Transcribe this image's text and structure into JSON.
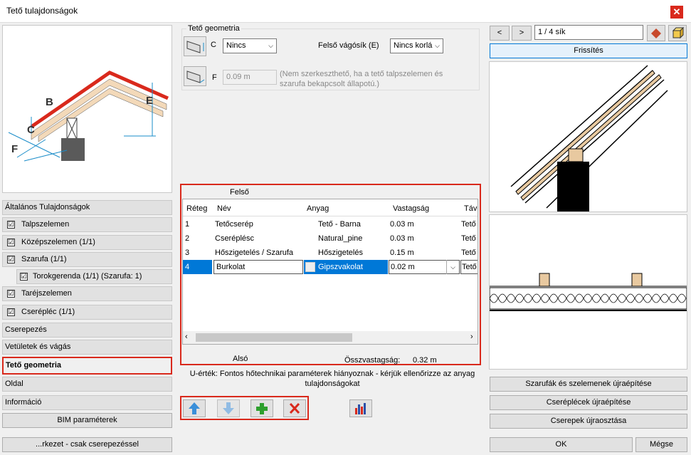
{
  "window": {
    "title": "Tető tulajdonságok",
    "close": "✕"
  },
  "nav": {
    "general": "Általános Tulajdonságok",
    "checks": [
      {
        "label": "Talpszelemen",
        "checked": "☑"
      },
      {
        "label": "Középszelemen (1/1)",
        "checked": "☑"
      },
      {
        "label": "Szarufa (1/1)",
        "checked": "☑"
      },
      {
        "label": "Torokgerenda (1/1) (Szarufa: 1)",
        "checked": "☑"
      },
      {
        "label": "Taréjszelemen",
        "checked": "☑"
      },
      {
        "label": "Cserépléc (1/1)",
        "checked": "☑"
      }
    ],
    "tiling": "Cserepezés",
    "projections": "Vetületek és vágás",
    "roof_geometry": "Tető geometria",
    "side": "Oldal",
    "info": "Információ",
    "bim": "BIM paraméterek",
    "bottom_btn": "...rkezet - csak cserepezéssel"
  },
  "diagram_labels": {
    "b": "B",
    "c": "C",
    "e": "E",
    "f": "F"
  },
  "geometry": {
    "title": "Tető geometria",
    "c_label": "C",
    "c_value": "Nincs",
    "upper_cut_label": "Felső vágósík (E)",
    "upper_cut_value": "Nincs korlá",
    "f_label": "F",
    "f_value": "0.09 m",
    "note": "(Nem szerkeszthető, ha a tető talpszelemen és szarufa bekapcsolt állapotú.)"
  },
  "layers": {
    "top_label": "Felső",
    "columns": [
      "Réteg",
      "Név",
      "Anyag",
      "Vastagság",
      "Távo"
    ],
    "rows": [
      {
        "n": "1",
        "name": "Tetőcserép",
        "material": "Tető - Barna",
        "thickness": "0.03 m",
        "dist": "Tető"
      },
      {
        "n": "2",
        "name": "Cseréplésc",
        "material": "Natural_pine",
        "thickness": "0.03 m",
        "dist": "Tető"
      },
      {
        "n": "3",
        "name": "Hőszigetelés / Szarufa",
        "material": "Hőszigetelés",
        "thickness": "0.15 m",
        "dist": "Tető"
      },
      {
        "n": "4",
        "name": "Burkolat",
        "material": "Gipszvakolat",
        "thickness": "0.02 m",
        "dist": "Tető"
      }
    ],
    "bottom_label": "Alsó",
    "total_label": "Összvastagság:",
    "total_value": "0.32 m"
  },
  "warning": "U-érték: Fontos hőtechnikai paraméterek hiányoznak - kérjük ellenőrizze az anyag tulajdonságokat",
  "preview": {
    "prev": "<",
    "next": ">",
    "page": "1 / 4 sík",
    "refresh": "Frissítés"
  },
  "right_buttons": {
    "rebuild_rafters": "Szarufák és szelemenek újraépítése",
    "rebuild_battens": "Cseréplécek újraépítése",
    "redistribute": "Cserepek újraosztása"
  },
  "footer": {
    "ok": "OK",
    "cancel": "Mégse"
  },
  "colors": {
    "accent": "#d9291c",
    "selection": "#0078d7",
    "material": "#e8c9a0"
  }
}
